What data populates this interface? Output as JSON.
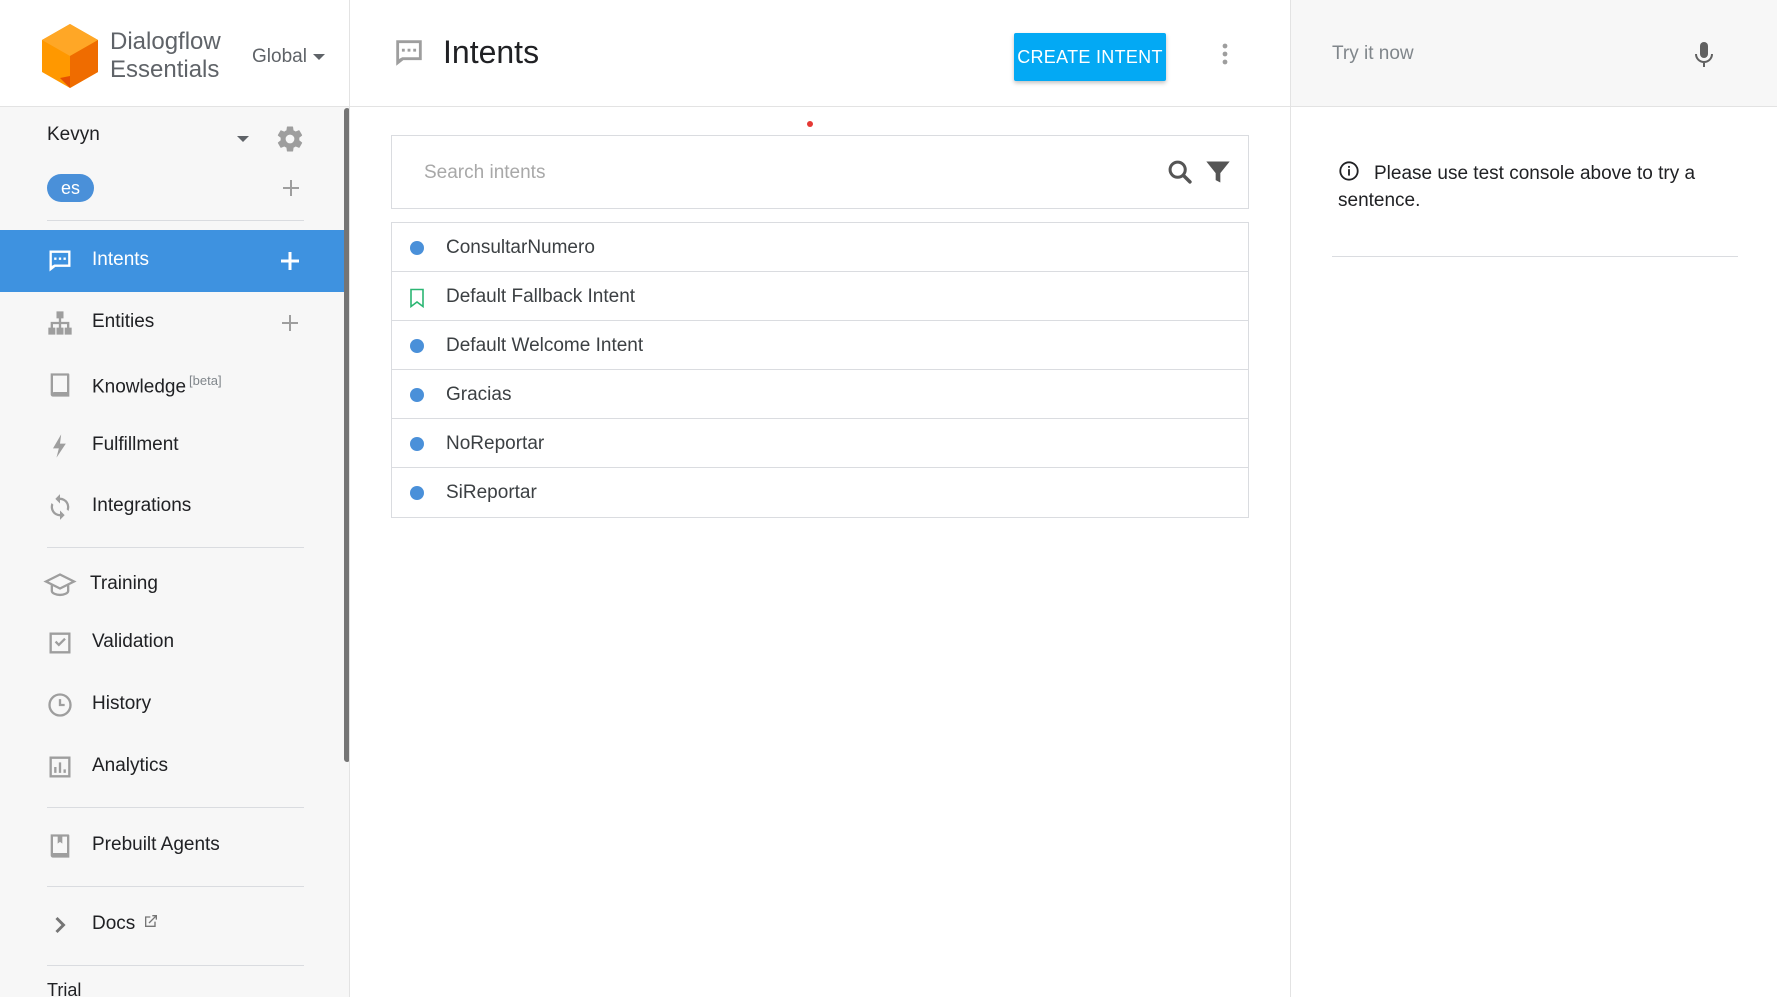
{
  "brand": {
    "name_line1": "Dialogflow",
    "name_line2": "Essentials",
    "region": "Global"
  },
  "agent": {
    "name": "Kevyn",
    "language": "es"
  },
  "nav": {
    "intents": "Intents",
    "entities": "Entities",
    "knowledge": "Knowledge",
    "knowledge_badge": "[beta]",
    "fulfillment": "Fulfillment",
    "integrations": "Integrations",
    "training": "Training",
    "validation": "Validation",
    "history": "History",
    "analytics": "Analytics",
    "prebuilt_agents": "Prebuilt Agents",
    "docs": "Docs",
    "trial": "Trial"
  },
  "main": {
    "title": "Intents",
    "create_button": "CREATE INTENT",
    "search_placeholder": "Search intents",
    "intents": [
      {
        "name": "ConsultarNumero",
        "marker": "dot"
      },
      {
        "name": "Default Fallback Intent",
        "marker": "bookmark"
      },
      {
        "name": "Default Welcome Intent",
        "marker": "dot"
      },
      {
        "name": "Gracias",
        "marker": "dot"
      },
      {
        "name": "NoReportar",
        "marker": "dot"
      },
      {
        "name": "SiReportar",
        "marker": "dot"
      }
    ]
  },
  "console": {
    "placeholder": "Try it now",
    "info_text": "Please use test console above to try a sentence."
  },
  "colors": {
    "accent": "#03a9f4",
    "active_nav": "#3e92e0",
    "intent_dot": "#4a90d9",
    "logo_orange": "#f57c00"
  }
}
